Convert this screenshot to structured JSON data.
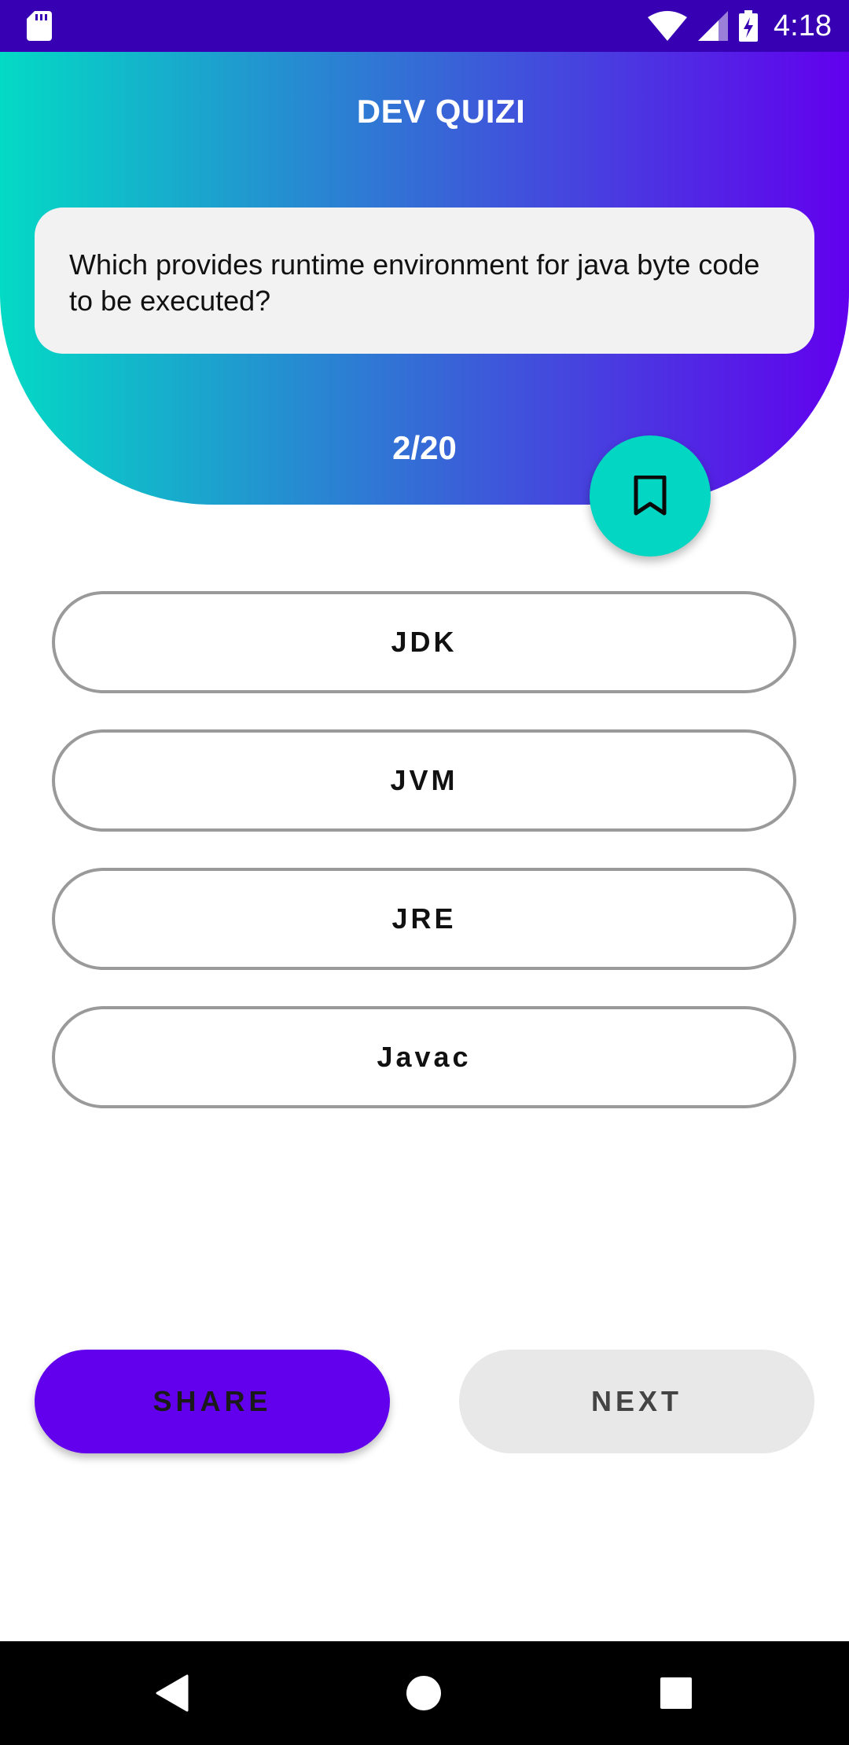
{
  "status_bar": {
    "time": "4:18",
    "icons": [
      "sd-card-icon",
      "wifi-icon",
      "cell-signal-icon",
      "battery-charging-icon"
    ]
  },
  "header": {
    "title": "DEV QUIZI",
    "question": "Which provides runtime environment for java byte code to be executed?",
    "progress": "2/20"
  },
  "bookmark": {
    "icon": "bookmark-icon"
  },
  "options": [
    {
      "label": "JDK"
    },
    {
      "label": "JVM"
    },
    {
      "label": "JRE"
    },
    {
      "label": "Javac"
    }
  ],
  "actions": {
    "share_label": "SHARE",
    "next_label": "NEXT"
  },
  "nav_bar": {
    "icons": [
      "back-icon",
      "home-icon",
      "recents-icon"
    ]
  },
  "colors": {
    "status_bar": "#3700b3",
    "gradient_start": "#03dac5",
    "gradient_end": "#6200ee",
    "fab": "#03d6c2",
    "share_button": "#6200ee",
    "next_button": "#e8e8e8",
    "option_border": "#9a9a9a"
  }
}
